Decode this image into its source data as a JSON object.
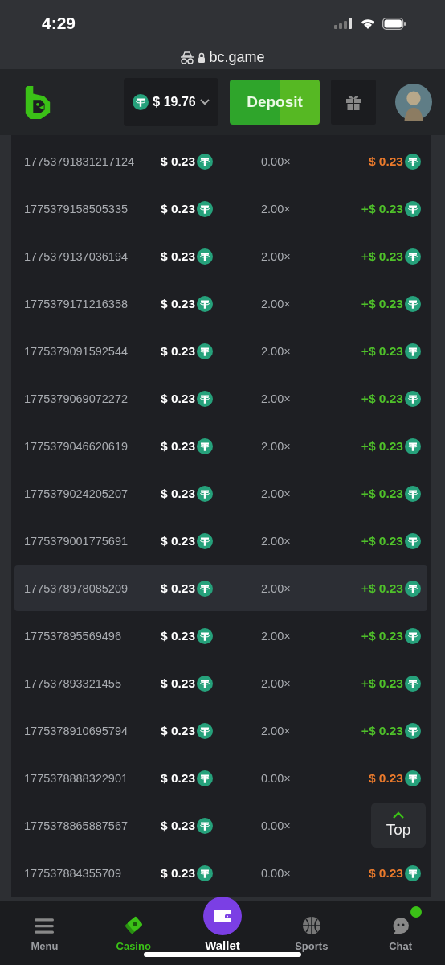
{
  "status_bar": {
    "time": "4:29"
  },
  "address_bar": {
    "url": "bc.game",
    "private": true,
    "secure": true
  },
  "header": {
    "balance": "$ 19.76",
    "deposit": "Deposit"
  },
  "bets": [
    {
      "id": "17753791831217124",
      "bet": "$ 0.23",
      "payout": "0.00×",
      "result": "$ 0.23",
      "kind": "loss",
      "selected": false
    },
    {
      "id": "1775379158505335",
      "bet": "$ 0.23",
      "payout": "2.00×",
      "result": "+$ 0.23",
      "kind": "win",
      "selected": false
    },
    {
      "id": "1775379137036194",
      "bet": "$ 0.23",
      "payout": "2.00×",
      "result": "+$ 0.23",
      "kind": "win",
      "selected": false
    },
    {
      "id": "1775379171216358",
      "bet": "$ 0.23",
      "payout": "2.00×",
      "result": "+$ 0.23",
      "kind": "win",
      "selected": false
    },
    {
      "id": "1775379091592544",
      "bet": "$ 0.23",
      "payout": "2.00×",
      "result": "+$ 0.23",
      "kind": "win",
      "selected": false
    },
    {
      "id": "1775379069072272",
      "bet": "$ 0.23",
      "payout": "2.00×",
      "result": "+$ 0.23",
      "kind": "win",
      "selected": false
    },
    {
      "id": "1775379046620619",
      "bet": "$ 0.23",
      "payout": "2.00×",
      "result": "+$ 0.23",
      "kind": "win",
      "selected": false
    },
    {
      "id": "1775379024205207",
      "bet": "$ 0.23",
      "payout": "2.00×",
      "result": "+$ 0.23",
      "kind": "win",
      "selected": false
    },
    {
      "id": "1775379001775691",
      "bet": "$ 0.23",
      "payout": "2.00×",
      "result": "+$ 0.23",
      "kind": "win",
      "selected": false
    },
    {
      "id": "1775378978085209",
      "bet": "$ 0.23",
      "payout": "2.00×",
      "result": "+$ 0.23",
      "kind": "win",
      "selected": true
    },
    {
      "id": "177537895569496",
      "bet": "$ 0.23",
      "payout": "2.00×",
      "result": "+$ 0.23",
      "kind": "win",
      "selected": false
    },
    {
      "id": "177537893321455",
      "bet": "$ 0.23",
      "payout": "2.00×",
      "result": "+$ 0.23",
      "kind": "win",
      "selected": false
    },
    {
      "id": "1775378910695794",
      "bet": "$ 0.23",
      "payout": "2.00×",
      "result": "+$ 0.23",
      "kind": "win",
      "selected": false
    },
    {
      "id": "1775378888322901",
      "bet": "$ 0.23",
      "payout": "0.00×",
      "result": "$ 0.23",
      "kind": "loss",
      "selected": false
    },
    {
      "id": "1775378865887567",
      "bet": "$ 0.23",
      "payout": "0.00×",
      "selected": false
    },
    {
      "id": "177537884355709",
      "bet": "$ 0.23",
      "payout": "0.00×",
      "result": "$ 0.23",
      "kind": "loss",
      "selected": false
    }
  ],
  "top_button": "Top",
  "nav": [
    {
      "label": "Menu",
      "kind": "menu",
      "selected": false
    },
    {
      "label": "Casino",
      "kind": "casino",
      "selected": true
    },
    {
      "label": "Wallet",
      "kind": "wallet",
      "selected": false
    },
    {
      "label": "Sports",
      "kind": "sports",
      "selected": false
    },
    {
      "label": "Chat",
      "kind": "chat",
      "selected": false,
      "unread": true
    }
  ]
}
